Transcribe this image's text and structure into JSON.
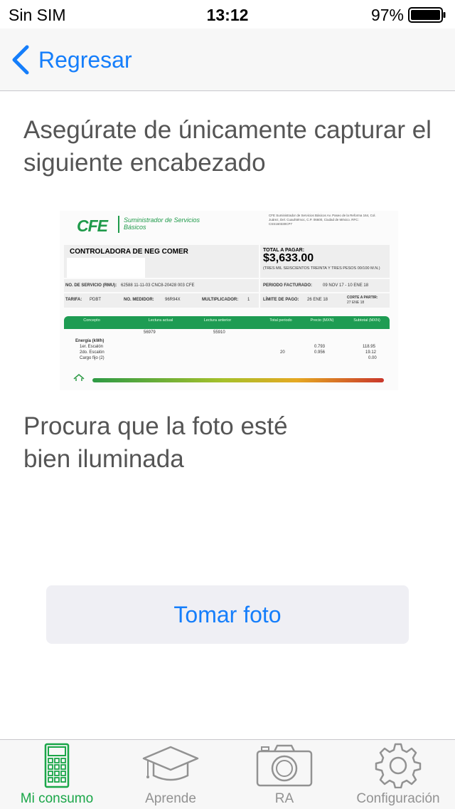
{
  "status_bar": {
    "carrier": "Sin SIM",
    "time": "13:12",
    "battery": "97%"
  },
  "nav": {
    "back_label": "Regresar"
  },
  "content": {
    "instruction_1": "Asegúrate de únicamente capturar el siguiente encabezado",
    "instruction_2": "Procura que la foto esté bien iluminada",
    "take_photo_label": "Tomar foto"
  },
  "receipt": {
    "logo": "CFE",
    "logo_subtitle": "Suministrador de Servicios Básicos",
    "address": "CFE Suministrador de Servicios Básicos Av. Paseo de la Reforma 164, Col. Juárez, Del. Cuauhtémoc, C.P. 06600, Ciudad de México. RFC: CSS160330CP7",
    "company": "CONTROLADORA DE NEG COMER",
    "total_label": "TOTAL A PAGAR:",
    "total_amount": "$3,633.00",
    "total_words": "(TRES MIL SEISCIENTOS TREINTA Y TRES PESOS 00/100 M.N.)",
    "service_number_label": "NO. DE SERVICIO (RMU):",
    "service_number": "62588 11-11-03 CNC8-20428 003 CFE",
    "period_label": "PERIODO FACTURADO:",
    "period": "09 NOV 17 - 10 ENE 18",
    "tariff_label": "TARIFA:",
    "tariff": "PDBT",
    "meter_label": "NO. MEDIDOR:",
    "meter": "96R94X",
    "multiplier_label": "MULTIPLICADOR:",
    "multiplier": "1",
    "due_label": "LÍMITE DE PAGO:",
    "due": "26 ENE 18",
    "cutoff_label": "CORTE A PARTIR:",
    "cutoff": "27 ENE 18",
    "table_headers": [
      "Concepto",
      "Lectura actual",
      "Lectura anterior",
      "Total periodo",
      "Precio (MXN)",
      "Subtotal (MXN)"
    ],
    "reading_current": "56979",
    "reading_previous": "55910",
    "energy_label": "Energía (kWh)",
    "rows": [
      {
        "concept": "1er. Escalón",
        "total": "",
        "price": "0.793",
        "subtotal": "118.95"
      },
      {
        "concept": "2do. Escalón",
        "total": "20",
        "price": "0.956",
        "subtotal": "19.12"
      },
      {
        "concept": "Cargo fijo (2)",
        "total": "",
        "price": "",
        "subtotal": "0.00"
      }
    ]
  },
  "tabs": [
    {
      "label": "Mi consumo",
      "icon": "calculator-icon",
      "active": true
    },
    {
      "label": "Aprende",
      "icon": "graduation-cap-icon",
      "active": false
    },
    {
      "label": "RA",
      "icon": "camera-icon",
      "active": false
    },
    {
      "label": "Configuración",
      "icon": "gear-icon",
      "active": false
    }
  ],
  "colors": {
    "accent_blue": "#157efb",
    "active_green": "#1aa648",
    "inactive_gray": "#929292",
    "text_gray": "#555555"
  }
}
